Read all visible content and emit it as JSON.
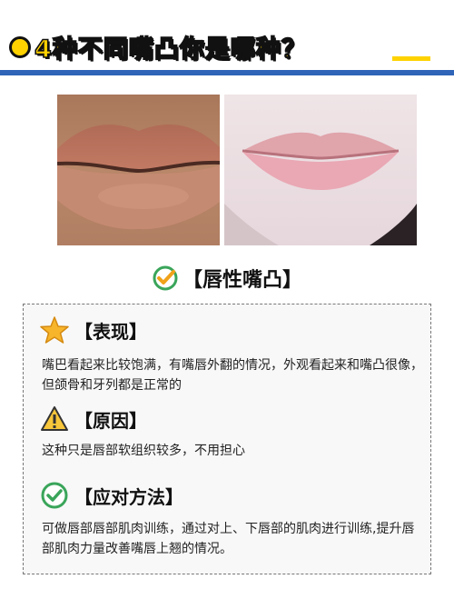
{
  "header": {
    "title": "4种不同嘴凸你是哪种？"
  },
  "section": {
    "title": "【唇性嘴凸】"
  },
  "items": [
    {
      "icon": "star-icon",
      "title": "【表现】",
      "text": "嘴巴看起来比较饱满，有嘴唇外翻的情况，外观看起来和嘴凸很像，但颌骨和牙列都是正常的"
    },
    {
      "icon": "warning-icon",
      "title": "【原因】",
      "text": "这种只是唇部软组织较多，不用担心"
    },
    {
      "icon": "check-circle-icon",
      "title": "【应对方法】",
      "text": "可做唇部唇部肌肉训练，通过对上、下唇部的肌肉进行训练,提升唇部肌肉力量改善嘴唇上翘的情况。"
    }
  ],
  "colors": {
    "accent": "#ffd200",
    "rule": "#2f64b8",
    "green": "#3aa55a"
  }
}
